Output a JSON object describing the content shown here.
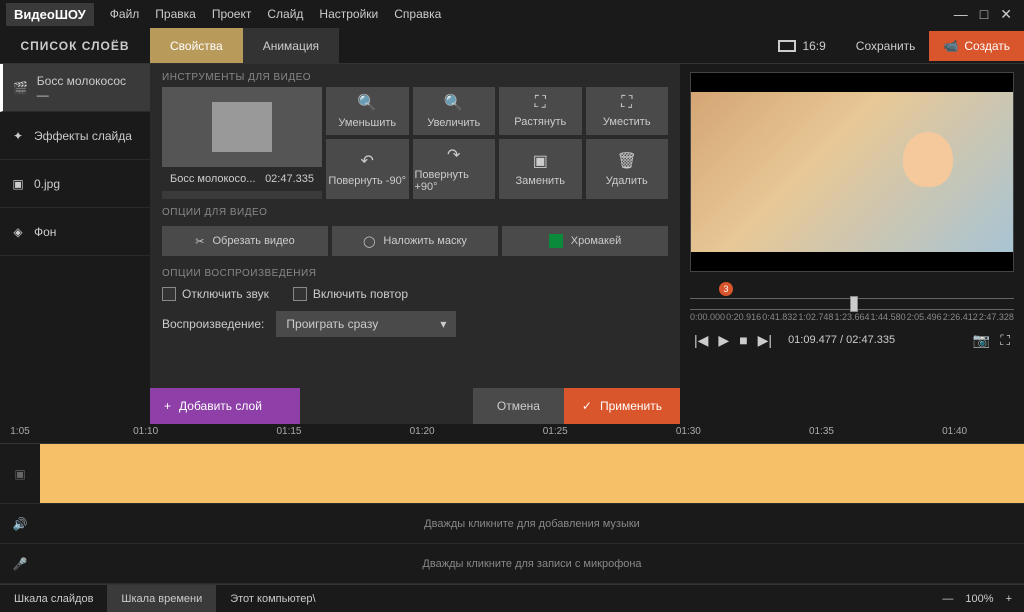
{
  "app": {
    "logo1": "Видео",
    "logo2": "ШОУ"
  },
  "menu": [
    "Файл",
    "Правка",
    "Проект",
    "Слайд",
    "Настройки",
    "Справка"
  ],
  "topbar": {
    "layers_title": "СПИСОК СЛОЁВ",
    "tab_props": "Свойства",
    "tab_anim": "Анимация",
    "aspect": "16:9",
    "save": "Сохранить",
    "create": "Создать"
  },
  "layers": [
    {
      "label": "Босс молокосос —",
      "icon": "film"
    },
    {
      "label": "Эффекты слайда",
      "icon": "wand"
    },
    {
      "label": "0.jpg",
      "icon": "image"
    },
    {
      "label": "Фон",
      "icon": "layers"
    }
  ],
  "center": {
    "section_tools": "ИНСТРУМЕНТЫ ДЛЯ ВИДЕО",
    "thumb_name": "Босс молокосо...",
    "thumb_time": "02:47.335",
    "tools": [
      "Уменьшить",
      "Увеличить",
      "Растянуть",
      "Уместить",
      "Повернуть -90°",
      "Повернуть +90°",
      "Заменить",
      "Удалить"
    ],
    "section_opts": "ОПЦИИ ДЛЯ ВИДЕО",
    "opt_crop": "Обрезать видео",
    "opt_mask": "Наложить маску",
    "opt_chroma": "Хромакей",
    "section_play": "ОПЦИИ ВОСПРОИЗВЕДЕНИЯ",
    "chk_mute": "Отключить звук",
    "chk_loop": "Включить повтор",
    "playback_label": "Воспроизведение:",
    "playback_value": "Проиграть сразу",
    "add_layer": "Добавить слой",
    "cancel": "Отмена",
    "apply": "Применить"
  },
  "preview": {
    "marker": "3",
    "ticks": [
      "0:00.000",
      "0:20.916",
      "0:41.832",
      "1:02.748",
      "1:23.664",
      "1:44.580",
      "2:05.496",
      "2:26.412",
      "2:47.328"
    ],
    "time": "01:09.477 / 02:47.335"
  },
  "timeline": {
    "ticks": [
      "1:05",
      "01:10",
      "01:15",
      "01:20",
      "01:25",
      "01:30",
      "01:35",
      "01:40"
    ],
    "music_hint": "Дважды кликните для добавления музыки",
    "mic_hint": "Дважды кликните для записи с микрофона"
  },
  "statusbar": {
    "tab_slides": "Шкала слайдов",
    "tab_time": "Шкала времени",
    "path": "Этот компьютер\\",
    "zoom": "100%"
  }
}
